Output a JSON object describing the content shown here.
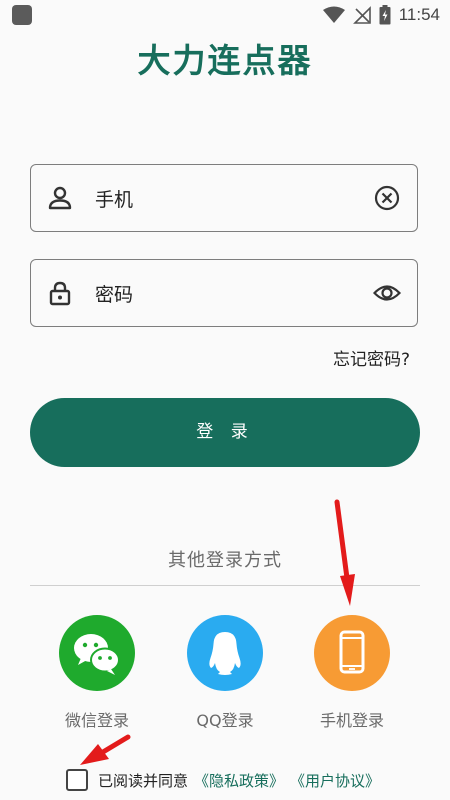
{
  "status_bar": {
    "time": "11:54"
  },
  "app": {
    "title": "大力连点器"
  },
  "form": {
    "phone": {
      "value": "手机"
    },
    "password": {
      "value": "密码"
    },
    "forgot_label": "忘记密码?",
    "login_label": "登 录"
  },
  "other_login": {
    "title": "其他登录方式",
    "methods": [
      {
        "label": "微信登录",
        "icon": "wechat-icon",
        "color": "#1faa2d"
      },
      {
        "label": "QQ登录",
        "icon": "qq-icon",
        "color": "#2aabf0"
      },
      {
        "label": "手机登录",
        "icon": "phone-icon",
        "color": "#f79b34"
      }
    ]
  },
  "agreement": {
    "text": "已阅读并同意",
    "privacy_link": "《隐私政策》",
    "terms_link": "《用户协议》",
    "checked": false
  },
  "colors": {
    "accent": "#176e5c",
    "annotation_arrow": "#e31b1b"
  }
}
